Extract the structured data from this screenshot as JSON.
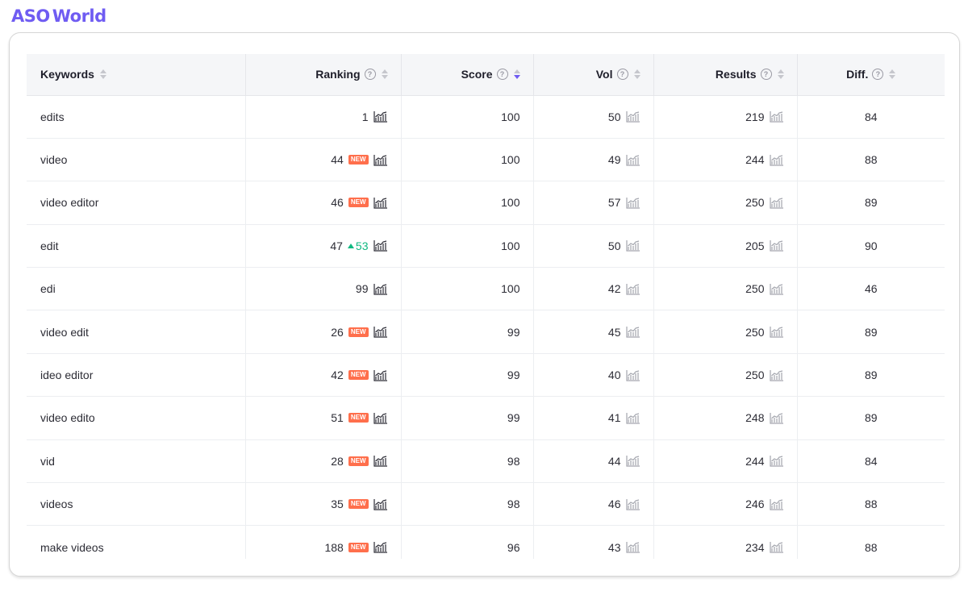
{
  "brand": {
    "logo_left": "ASO",
    "logo_right": "World"
  },
  "columns": {
    "keywords": "Keywords",
    "ranking": "Ranking",
    "score": "Score",
    "vol": "Vol",
    "results": "Results",
    "diff": "Diff.",
    "help_glyph": "?"
  },
  "badges": {
    "new": "NEW"
  },
  "rows": [
    {
      "keyword": "edits",
      "ranking": "1",
      "badge": "",
      "delta": "",
      "score": "100",
      "vol": "50",
      "results": "219",
      "diff": "84"
    },
    {
      "keyword": "video",
      "ranking": "44",
      "badge": "NEW",
      "delta": "",
      "score": "100",
      "vol": "49",
      "results": "244",
      "diff": "88"
    },
    {
      "keyword": "video editor",
      "ranking": "46",
      "badge": "NEW",
      "delta": "",
      "score": "100",
      "vol": "57",
      "results": "250",
      "diff": "89"
    },
    {
      "keyword": "edit",
      "ranking": "47",
      "badge": "",
      "delta": "53",
      "score": "100",
      "vol": "50",
      "results": "205",
      "diff": "90"
    },
    {
      "keyword": "edi",
      "ranking": "99",
      "badge": "",
      "delta": "",
      "score": "100",
      "vol": "42",
      "results": "250",
      "diff": "46"
    },
    {
      "keyword": "video edit",
      "ranking": "26",
      "badge": "NEW",
      "delta": "",
      "score": "99",
      "vol": "45",
      "results": "250",
      "diff": "89"
    },
    {
      "keyword": "ideo editor",
      "ranking": "42",
      "badge": "NEW",
      "delta": "",
      "score": "99",
      "vol": "40",
      "results": "250",
      "diff": "89"
    },
    {
      "keyword": "video edito",
      "ranking": "51",
      "badge": "NEW",
      "delta": "",
      "score": "99",
      "vol": "41",
      "results": "248",
      "diff": "89"
    },
    {
      "keyword": "vid",
      "ranking": "28",
      "badge": "NEW",
      "delta": "",
      "score": "98",
      "vol": "44",
      "results": "244",
      "diff": "84"
    },
    {
      "keyword": "videos",
      "ranking": "35",
      "badge": "NEW",
      "delta": "",
      "score": "98",
      "vol": "46",
      "results": "246",
      "diff": "88"
    },
    {
      "keyword": "make videos",
      "ranking": "188",
      "badge": "NEW",
      "delta": "",
      "score": "96",
      "vol": "43",
      "results": "234",
      "diff": "88"
    }
  ],
  "colors": {
    "accent": "#6f5cf2",
    "new_badge": "#ff6f4c",
    "rank_up": "#10b981",
    "chart_dark": "#2b2b35",
    "chart_light": "#a3a5ad"
  }
}
